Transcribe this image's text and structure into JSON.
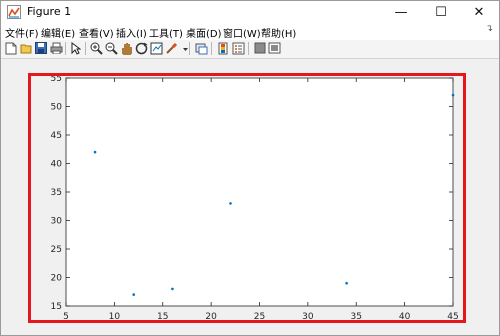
{
  "window": {
    "title": "Figure 1",
    "minimize_icon": "minimize-icon",
    "maximize_icon": "maximize-icon",
    "close_icon": "close-icon"
  },
  "menu": {
    "items": [
      "文件(F)",
      "编辑(E)",
      "查看(V)",
      "插入(I)",
      "工具(T)",
      "桌面(D)",
      "窗口(W)",
      "帮助(H)"
    ],
    "overflow_icon": "dock-arrow-icon"
  },
  "toolbar": {
    "icons": [
      "new-figure-icon",
      "open-icon",
      "save-icon",
      "print-icon",
      "pointer-icon",
      "zoom-in-icon",
      "zoom-out-icon",
      "pan-icon",
      "rotate-icon",
      "data-cursor-icon",
      "brush-icon",
      "link-plot-icon",
      "colorbar-icon",
      "legend-icon",
      "hide-plot-tools-icon",
      "show-plot-tools-icon"
    ]
  },
  "colors": {
    "marker": "#0072bd",
    "highlight_frame": "#e5171c",
    "axes_box": "#262626"
  },
  "chart_data": {
    "type": "scatter",
    "title": "",
    "xlabel": "",
    "ylabel": "",
    "xlim": [
      5,
      45
    ],
    "ylim": [
      15,
      55
    ],
    "xticks": [
      5,
      10,
      15,
      20,
      25,
      30,
      35,
      40,
      45
    ],
    "yticks": [
      15,
      20,
      25,
      30,
      35,
      40,
      45,
      50,
      55
    ],
    "grid": false,
    "x": [
      8,
      12,
      16,
      22,
      34,
      45
    ],
    "y": [
      42,
      17,
      18,
      33,
      19,
      52
    ]
  }
}
